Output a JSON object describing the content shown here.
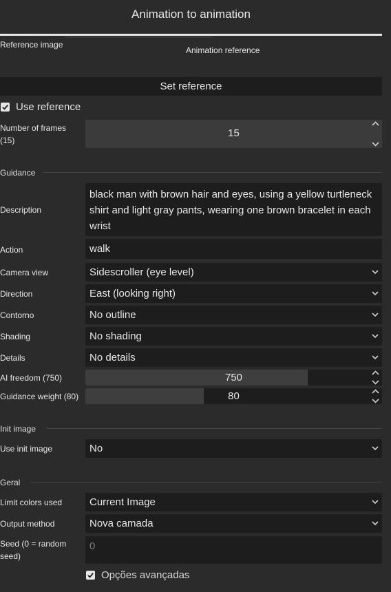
{
  "window": {
    "title": "Animation to animation"
  },
  "tabs": {
    "reference_image_label": "Reference image",
    "animation_reference_label": "Animation reference"
  },
  "set_reference_button": "Set reference",
  "use_reference": {
    "label": "Use reference",
    "checked": true
  },
  "frames": {
    "label_line1": "Number of frames",
    "label_line2": "(15)",
    "value": "15"
  },
  "guidance": {
    "section_title": "Guidance",
    "description_label": "Description",
    "description_value": "black man with brown hair and eyes, using a yellow turtleneck shirt and light gray pants, wearing one brown bracelet in each wrist",
    "action_label": "Action",
    "action_value": "walk",
    "camera_label": "Camera view",
    "camera_value": "Sidescroller (eye level)",
    "direction_label": "Direction",
    "direction_value": "East (looking right)",
    "outline_label": "Contorno",
    "outline_value": "No outline",
    "shading_label": "Shading",
    "shading_value": "No shading",
    "details_label": "Details",
    "details_value": "No details",
    "ai_freedom_label": "AI freedom (750)",
    "ai_freedom_value": "750",
    "ai_freedom_fraction": 0.75,
    "guidance_weight_label": "Guidance weight (80)",
    "guidance_weight_value": "80",
    "guidance_weight_fraction": 0.4
  },
  "init_image": {
    "section_title": "Init image",
    "use_label": "Use init image",
    "use_value": "No"
  },
  "general": {
    "section_title": "Geral",
    "limit_colors_label": "Limit colors used",
    "limit_colors_value": "Current Image",
    "output_label": "Output method",
    "output_value": "Nova camada",
    "seed_label_line1": "Seed (0 = random",
    "seed_label_line2": "seed)",
    "seed_placeholder": "0"
  },
  "advanced": {
    "label": "Opções avançadas",
    "checked": true
  },
  "colors": {
    "panel_bg": "#2b2b2b",
    "field_bg": "#1d1d1d",
    "text": "#e6e6e6"
  }
}
